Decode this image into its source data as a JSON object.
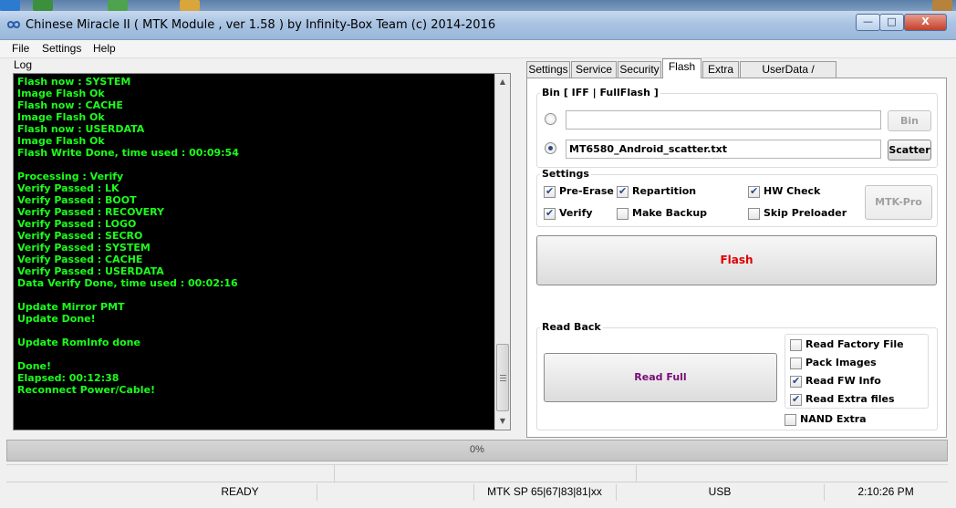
{
  "window": {
    "title": "Chinese Miracle II ( MTK Module , ver 1.58 ) by Infinity-Box Team (c) 2014-2016",
    "minimize": "—",
    "maximize": "□",
    "close": "X"
  },
  "menu": {
    "file": "File",
    "settings": "Settings",
    "help": "Help"
  },
  "log": {
    "label": "Log",
    "lines": [
      "Flash now : SYSTEM",
      "Image Flash Ok",
      "Flash now : CACHE",
      "Image Flash Ok",
      "Flash now : USERDATA",
      "Image Flash Ok",
      "Flash Write Done, time used : 00:09:54",
      "",
      "Processing : Verify",
      "Verify Passed : LK",
      "Verify Passed : BOOT",
      "Verify Passed : RECOVERY",
      "Verify Passed : LOGO",
      "Verify Passed : SECRO",
      "Verify Passed : SYSTEM",
      "Verify Passed : CACHE",
      "Verify Passed : USERDATA",
      "Data Verify Done, time used : 00:02:16",
      "",
      "Update Mirror PMT",
      "Update Done!",
      "",
      "Update RomInfo done",
      "",
      "Done!",
      "Elapsed: 00:12:38",
      "Reconnect Power/Cable!"
    ]
  },
  "tabs": [
    "Settings",
    "Service",
    "Security",
    "Flash",
    "Extra",
    "UserData / Forensic"
  ],
  "active_tab": "Flash",
  "flash": {
    "bin_group_label": "Bin  [ IFF | FullFlash ]",
    "bin_field_value": "",
    "bin_radio_selected": false,
    "bin_button": "Bin",
    "scatter_field_value": "MT6580_Android_scatter.txt",
    "scatter_radio_selected": true,
    "scatter_button": "Scatter",
    "settings_label": "Settings",
    "options": {
      "pre_erase": {
        "label": "Pre-Erase",
        "checked": true
      },
      "repartition": {
        "label": "Repartition",
        "checked": true
      },
      "hw_check": {
        "label": "HW Check",
        "checked": true
      },
      "verify": {
        "label": "Verify",
        "checked": true
      },
      "make_backup": {
        "label": "Make Backup",
        "checked": false
      },
      "skip_preloader": {
        "label": "Skip Preloader",
        "checked": false
      }
    },
    "mtk_pro_button": "MTK-Pro",
    "flash_button": "Flash",
    "flash_button_color": "#e00000",
    "readback_label": "Read Back",
    "read_full_button": "Read Full",
    "read_full_color": "#7a0a7a",
    "read_options": {
      "read_factory_file": {
        "label": "Read Factory File",
        "checked": false
      },
      "pack_images": {
        "label": "Pack Images",
        "checked": false
      },
      "read_fw_info": {
        "label": "Read FW Info",
        "checked": true
      },
      "read_extra_files": {
        "label": "Read Extra files",
        "checked": true
      }
    },
    "nand_extra": {
      "label": "NAND Extra",
      "checked": false
    }
  },
  "progress": {
    "text": "0%",
    "value": 0
  },
  "status": {
    "state": "READY",
    "chipset": "MTK SP 65|67|83|81|xx",
    "connection": "USB",
    "time": "2:10:26 PM"
  },
  "colors": {
    "log_text": "#1bff1b",
    "log_bg": "#000000"
  }
}
